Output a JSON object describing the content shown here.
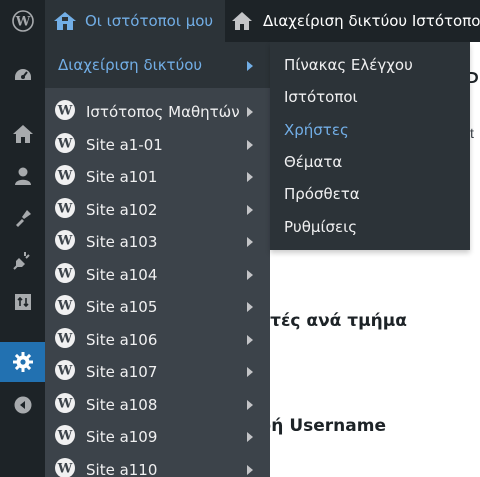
{
  "admin_bar": {
    "my_sites_label": "Οι ιστότοποι μου",
    "network_label": "Διαχείριση δικτύου Ιστότοπος"
  },
  "network_menu": {
    "label": "Διαχείριση δικτύου",
    "items": [
      "Πίνακας Ελέγχου",
      "Ιστότοποι",
      "Χρήστες",
      "Θέματα",
      "Πρόσθετα",
      "Ρυθμίσεις"
    ],
    "hovered_item": "Χρήστες"
  },
  "sites": [
    "Ιστότοπος Μαθητών",
    "Site a1-01",
    "Site a101",
    "Site a102",
    "Site a103",
    "Site a104",
    "Site a105",
    "Site a106",
    "Site a107",
    "Site a108",
    "Site a109",
    "Site a110"
  ],
  "sidebar_icons": [
    "dashboard-icon",
    "sites-icon",
    "users-icon",
    "themes-icon",
    "plugins-icon",
    "updates-icon",
    "settings-icon",
    "collapse-icon"
  ],
  "content": {
    "title_fragment": "P",
    "subtext_fragment": "t",
    "heading_1": "ητές ανά τμήμα",
    "heading_2": "φή Username"
  },
  "colors": {
    "adminbar_bg": "#1d2327",
    "submenu_bg": "#2c3338",
    "sites_bg": "#3c434a",
    "accent": "#72aee6",
    "active_blue": "#2271b1"
  }
}
